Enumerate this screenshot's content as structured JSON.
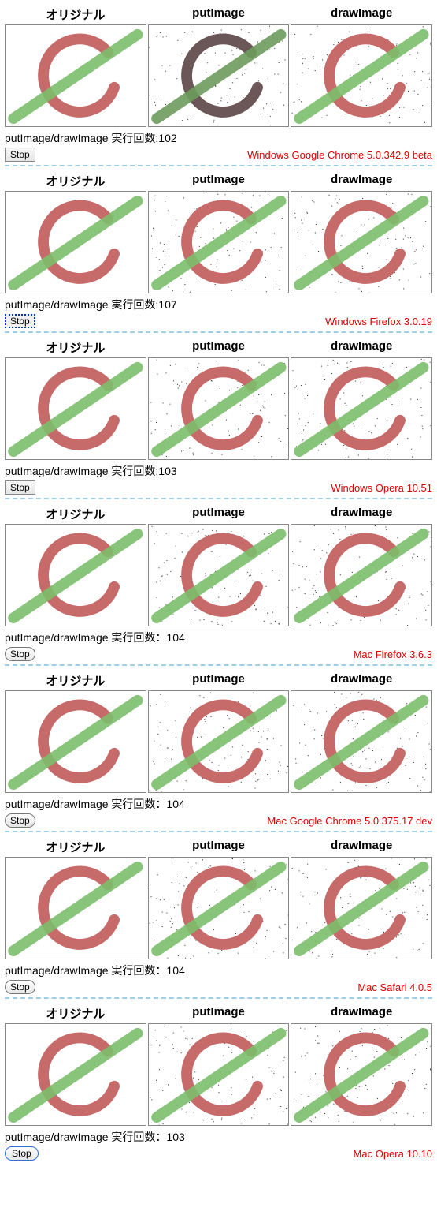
{
  "headers": {
    "original": "オリジナル",
    "putImage": "putImage",
    "drawImage": "drawImage"
  },
  "count_prefix": "putImage/drawImage 実行回数",
  "stop_label": "Stop",
  "sections": [
    {
      "count_sep": ":",
      "count": 102,
      "browser": "Windows Google Chrome 5.0.342.9 beta",
      "btn": "win",
      "dark_put": true
    },
    {
      "count_sep": ":",
      "count": 107,
      "browser": "Windows Firefox 3.0.19",
      "btn": "ff",
      "dark_put": false
    },
    {
      "count_sep": ":",
      "count": 103,
      "browser": "Windows Opera 10.51",
      "btn": "win",
      "dark_put": false
    },
    {
      "count_sep": "：",
      "count": 104,
      "browser": "Mac Firefox 3.6.3",
      "btn": "pill",
      "dark_put": false
    },
    {
      "count_sep": "：",
      "count": 104,
      "browser": "Mac Google Chrome  5.0.375.17 dev",
      "btn": "pill",
      "dark_put": false
    },
    {
      "count_sep": "：",
      "count": 104,
      "browser": "Mac Safari 4.0.5",
      "btn": "pill",
      "dark_put": false
    },
    {
      "count_sep": "：",
      "count": 103,
      "browser": "Mac Opera 10.10",
      "btn": "mac-blue",
      "dark_put": false
    }
  ]
}
